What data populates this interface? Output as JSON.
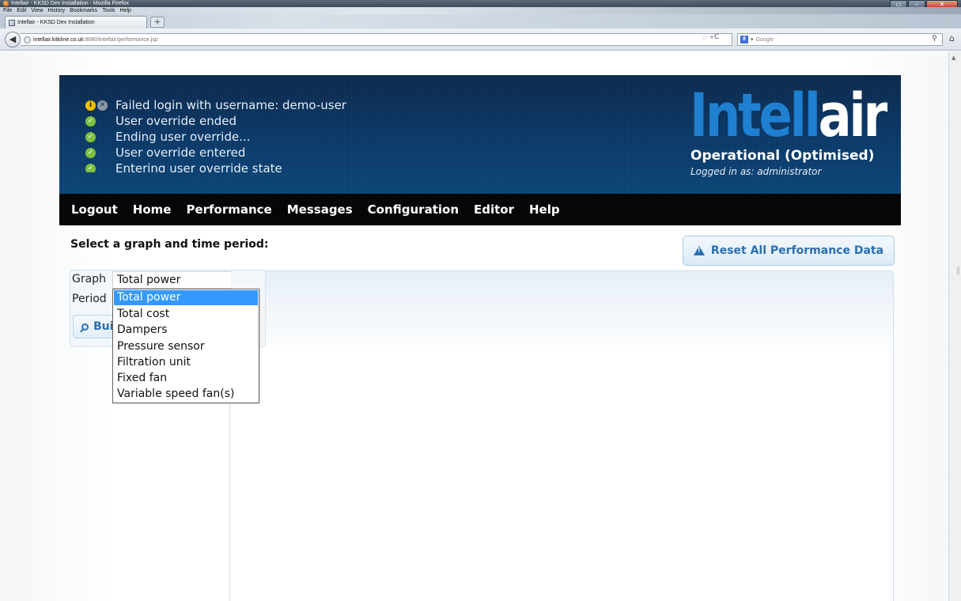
{
  "browser": {
    "window_title": "Intellair - KKSD Dev Installation - Mozilla Firefox",
    "menu": [
      "File",
      "Edit",
      "View",
      "History",
      "Bookmarks",
      "Tools",
      "Help"
    ],
    "tab_title": "Intellair - KKSD Dev Installation",
    "new_tab": "+",
    "url_host": "intellair.kitkline.co.uk",
    "url_rest": ":8080/intellair/performance.jsp",
    "search_placeholder": "Google"
  },
  "header": {
    "messages": [
      {
        "icons": [
          "info",
          "error"
        ],
        "text": "Failed login with username: demo-user"
      },
      {
        "icons": [
          "check"
        ],
        "text": "User override ended"
      },
      {
        "icons": [
          "check"
        ],
        "text": "Ending user override..."
      },
      {
        "icons": [
          "check"
        ],
        "text": "User override entered"
      },
      {
        "icons": [
          "check"
        ],
        "text": "Entering user override state"
      }
    ],
    "brand_part1": "Intell",
    "brand_part2": "air",
    "status": "Operational (Optimised)",
    "logged_in": "Logged in as: administrator"
  },
  "nav": [
    "Logout",
    "Home",
    "Performance",
    "Messages",
    "Configuration",
    "Editor",
    "Help"
  ],
  "main": {
    "section_title": "Select a graph and time period:",
    "reset_button": "Reset All Performance Data",
    "graph_label": "Graph",
    "period_label": "Period",
    "graph_selected": "Total power",
    "build_button": "Build",
    "graph_options": [
      "Total power",
      "Total cost",
      "Dampers",
      "Pressure sensor",
      "Filtration unit",
      "Fixed fan",
      "Variable speed fan(s)"
    ],
    "highlighted_option": "Total power"
  },
  "colors": {
    "header_bg": "#0b3a6a",
    "brand_blue": "#1f7fd0",
    "nav_bg": "#060606",
    "link_blue": "#2a6fb0",
    "selection": "#3399ff"
  }
}
